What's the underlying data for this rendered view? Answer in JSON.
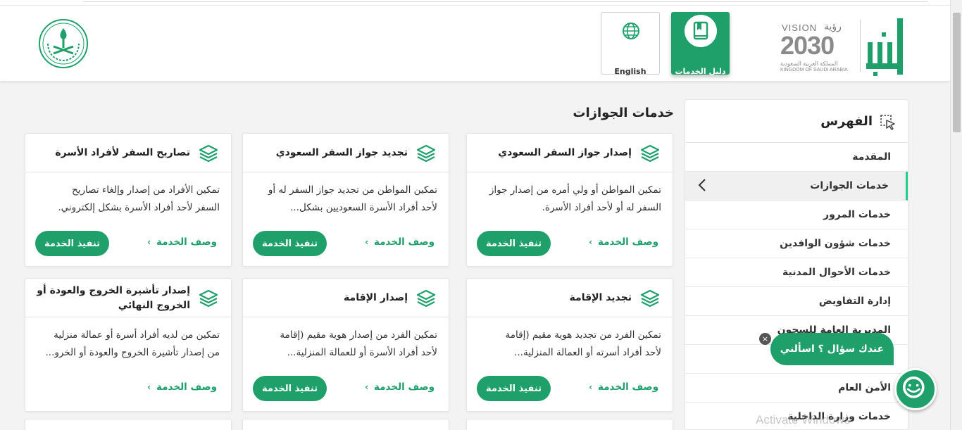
{
  "header": {
    "english_label": "English",
    "guide_label": "دليل الخدمات",
    "vision": {
      "line1": "VISION",
      "year": "2030",
      "line3": "المملكة العربية السعودية",
      "line4": "KINGDOM OF SAUDI ARABIA",
      "arabic": "رؤية"
    },
    "colors": {
      "brand": "#1fa06a",
      "vision_gray": "#8a8a8a"
    },
    "icons": [
      "saudi-emblem-icon",
      "globe-icon",
      "book-icon",
      "absher-logo"
    ]
  },
  "main": {
    "section_title": "خدمات الجوازات",
    "exec_label": "تنفيذ الخدمة",
    "desc_label": "وصف الخدمة",
    "cards": [
      {
        "title": "إصدار جواز السفر السعودي",
        "desc": [
          "تمكين المواطن أو ولي أمره من إصدار جواز",
          "السفر له أو لأحد أفراد الأسرة."
        ]
      },
      {
        "title": "تجديد جواز السفر السعودي",
        "desc": [
          "تمكين المواطن من تجديد جواز السفر له أو",
          "لأحد أفراد الأسرة السعوديين بشكل..."
        ]
      },
      {
        "title": "تصاريح السفر لأفراد الأسرة",
        "desc": [
          "تمكين الأفراد من إصدار وإلغاء تصاريح",
          "السفر لأحد أفراد الأسرة بشكل إلكتروني."
        ]
      },
      {
        "title": "تجديد الإقامة",
        "desc": [
          "تمكين الفرد من تجديد هوية مقيم (إقامة",
          "لأحد أفراد أسرته أو العمالة المنزلية..."
        ]
      },
      {
        "title": "إصدار الإقامة",
        "desc": [
          "تمكين الفرد من إصدار هوية مقيم (إقامة",
          "لأحد أفراد الأسرة أو للعمالة المنزلية..."
        ]
      },
      {
        "title_line1": "إصدار تأشيرة الخروج والعودة أو",
        "title_line2": "الخروج النهائي",
        "desc": [
          "تمكين من لديه أفراد أسرة أو عمالة منزلية",
          "من إصدار تأشيرة الخروج والعودة أو الخرو..."
        ]
      }
    ]
  },
  "sidebar": {
    "title": "الفهرس",
    "items": [
      "المقدمة",
      "خدمات الجوازات",
      "خدمات المرور",
      "خدمات شؤون الوافدين",
      "خدمات الأحوال المدنية",
      "إدارة التفاويض",
      "المديرية العامة للسجون",
      "",
      "الأمن العام",
      "خدمات وزارة الداخلية"
    ],
    "active_index": 1
  },
  "chat": {
    "bubble": "عندك سؤال ؟ اسألني",
    "close": "×"
  },
  "watermark": "Activate Windows"
}
